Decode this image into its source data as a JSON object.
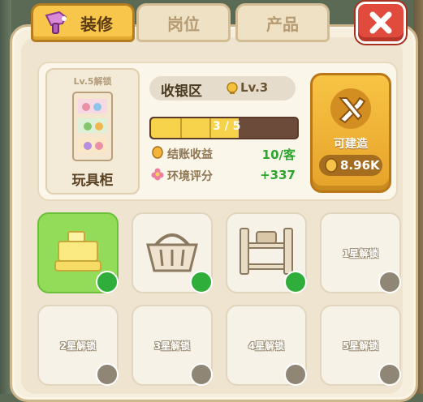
{
  "tabs": [
    {
      "label": "装修",
      "active": true
    },
    {
      "label": "岗位",
      "active": false
    },
    {
      "label": "产品",
      "active": false
    }
  ],
  "item": {
    "unlock_label": "Lv.5解锁",
    "name": "玩具柜"
  },
  "area": {
    "name": "收银区",
    "level": "Lv.3"
  },
  "progress": {
    "text": "3 / 5",
    "current": 3,
    "max": 5
  },
  "stats": [
    {
      "label": "结账收益",
      "value": "10/客",
      "icon": "coin-icon"
    },
    {
      "label": "环境评分",
      "value": "+337",
      "icon": "flower-icon"
    }
  ],
  "build": {
    "label": "可建造",
    "cost": "8.96K"
  },
  "tiles": [
    {
      "name": "cash-register",
      "label": "",
      "state": "selected"
    },
    {
      "name": "basket",
      "label": "",
      "state": "upgrade"
    },
    {
      "name": "shelf",
      "label": "",
      "state": "upgrade"
    },
    {
      "name": "locked-1",
      "label": "1星解锁",
      "state": "locked"
    },
    {
      "name": "locked-2",
      "label": "2星解锁",
      "state": "locked"
    },
    {
      "name": "locked-3",
      "label": "3星解锁",
      "state": "locked"
    },
    {
      "name": "locked-4",
      "label": "4星解锁",
      "state": "locked"
    },
    {
      "name": "locked-5",
      "label": "5星解锁",
      "state": "locked"
    }
  ],
  "colors": {
    "accent": "#f8c64a",
    "progress_fill": "#f7d24b",
    "positive": "#2ea32e",
    "close": "#e04b3d"
  }
}
